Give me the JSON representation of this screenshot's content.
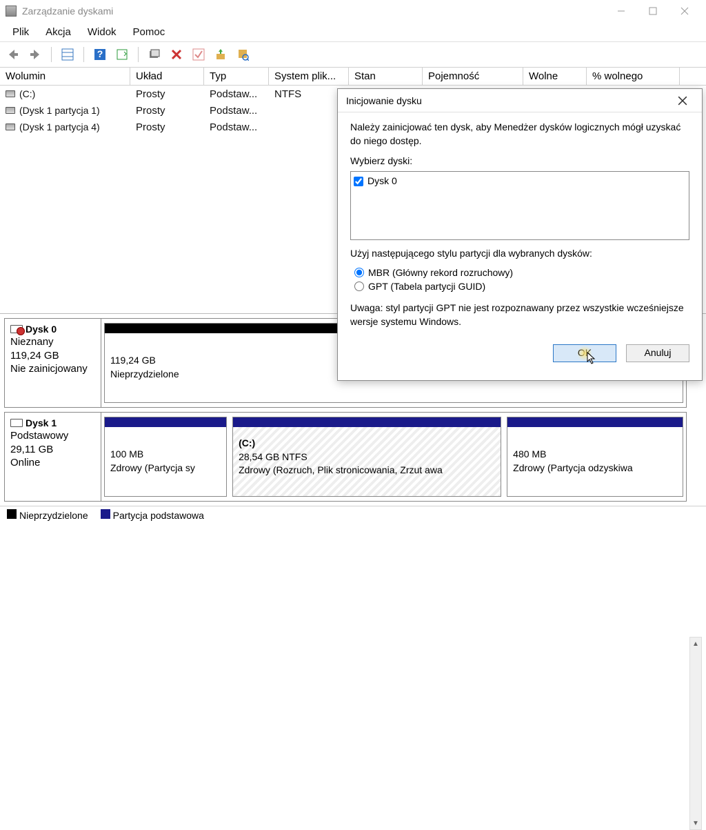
{
  "window": {
    "title": "Zarządzanie dyskami"
  },
  "menu": {
    "file": "Plik",
    "action": "Akcja",
    "view": "Widok",
    "help": "Pomoc"
  },
  "columns": {
    "vol": "Wolumin",
    "layout": "Układ",
    "type": "Typ",
    "fs": "System plik...",
    "status": "Stan",
    "cap": "Pojemność",
    "free": "Wolne",
    "pct": "% wolnego"
  },
  "volumes": [
    {
      "name": "(C:)",
      "layout": "Prosty",
      "type": "Podstaw...",
      "fs": "NTFS"
    },
    {
      "name": "(Dysk 1 partycja 1)",
      "layout": "Prosty",
      "type": "Podstaw...",
      "fs": ""
    },
    {
      "name": "(Dysk 1 partycja 4)",
      "layout": "Prosty",
      "type": "Podstaw...",
      "fs": ""
    }
  ],
  "disks": [
    {
      "name": "Dysk 0",
      "type": "Nieznany",
      "size": "119,24 GB",
      "status": "Nie zainicjowany",
      "unknown": true,
      "parts": [
        {
          "top_color": "#000000",
          "size": "119,24 GB",
          "status": "Nieprzydzielone",
          "width_pct": 100,
          "hatch": false,
          "label": ""
        }
      ]
    },
    {
      "name": "Dysk 1",
      "type": "Podstawowy",
      "size": "29,11 GB",
      "status": "Online",
      "unknown": false,
      "parts": [
        {
          "top_color": "#1a1a8a",
          "label": "",
          "size": "100 MB",
          "status": "Zdrowy (Partycja sy",
          "width_pct": 21,
          "hatch": false
        },
        {
          "top_color": "#1a1a8a",
          "label": "(C:)",
          "size": "28,54 GB NTFS",
          "status": "Zdrowy (Rozruch, Plik stronicowania, Zrzut awa",
          "width_pct": 47,
          "hatch": true
        },
        {
          "top_color": "#1a1a8a",
          "label": "",
          "size": "480 MB",
          "status": "Zdrowy (Partycja odzyskiwa",
          "width_pct": 32,
          "hatch": false
        }
      ]
    }
  ],
  "legend": {
    "unalloc": "Nieprzydzielone",
    "primary": "Partycja podstawowa"
  },
  "dialog": {
    "title": "Inicjowanie dysku",
    "msg": "Należy zainicjować ten dysk, aby Menedżer dysków logicznych mógł uzyskać do niego dostęp.",
    "select_label": "Wybierz dyski:",
    "disk_item": "Dysk 0",
    "style_label": "Użyj następującego stylu partycji dla wybranych dysków:",
    "mbr": "MBR (Główny rekord rozruchowy)",
    "gpt": "GPT (Tabela partycji GUID)",
    "note": "Uwaga: styl partycji GPT nie jest rozpoznawany przez wszystkie wcześniejsze wersje systemu Windows.",
    "ok": "OK",
    "cancel": "Anuluj"
  },
  "colors": {
    "black": "#000000",
    "navy": "#1a1a8a"
  }
}
